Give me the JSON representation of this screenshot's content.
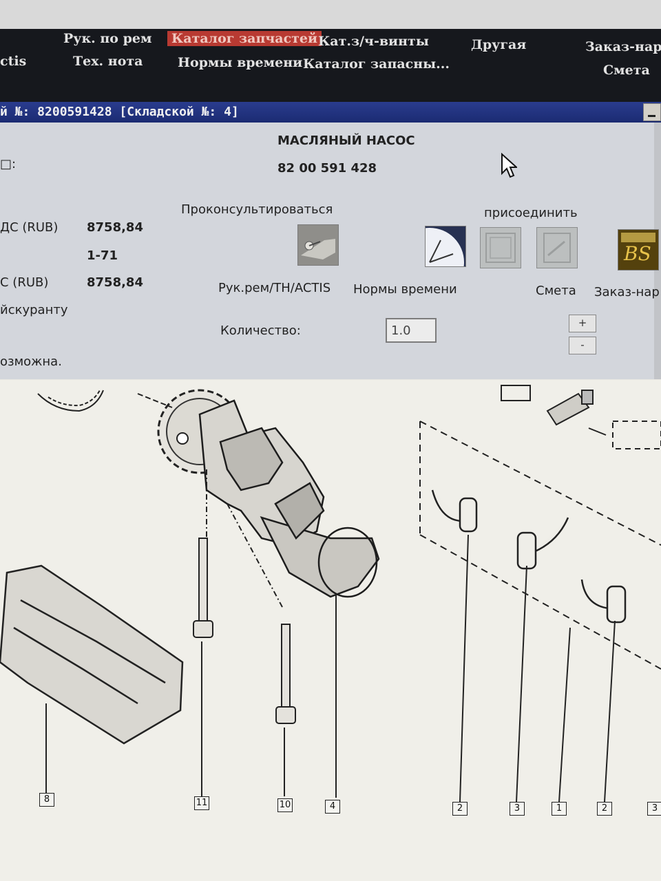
{
  "menu": {
    "actis": "ctis",
    "repair_manual": "Рук. по рем",
    "tech_note": "Тех. нота",
    "parts_catalog": "Каталог запчастей",
    "time_norms": "Нормы времени",
    "bolts_catalog": "Кат.з/ч-винты",
    "spare_catalog": "Каталог запасны...",
    "other": "Другая",
    "work_order": "Заказ-наряд",
    "estimate": "Смета"
  },
  "dialog": {
    "title": "й №: 8200591428 [Складской №: 4]",
    "part_name": "МАСЛЯНЫЙ НАСОС",
    "part_number": "82 00 591 428",
    "left_checkbox_label": "□:",
    "price_with_vat_label": "ДС (RUB)",
    "price_with_vat_value": "8758,84",
    "code_value": "1-71",
    "price_label": "С (RUB)",
    "price_value": "8758,84",
    "pricelist_label": "йскуранту",
    "possible_label": "озможна.",
    "consult_label": "Проконсультироваться",
    "attach_label": "присоединить",
    "manual_label": "Рук.рем/TH/ACTIS",
    "norms_label": "Нормы времени",
    "estimate_label": "Смета",
    "work_order_label": "Заказ-нар",
    "quantity_label": "Количество:",
    "quantity_value": "1.0",
    "plus_label": "+",
    "minus_label": "-"
  },
  "diagram": {
    "callouts": [
      "8",
      "11",
      "10",
      "4",
      "2",
      "3",
      "1",
      "2",
      "3"
    ]
  },
  "colors": {
    "menu_bg": "#16181d",
    "active_menu": "#b83a32",
    "titlebar": "#1f2f7a",
    "dialog_bg": "#d3d6dc"
  }
}
